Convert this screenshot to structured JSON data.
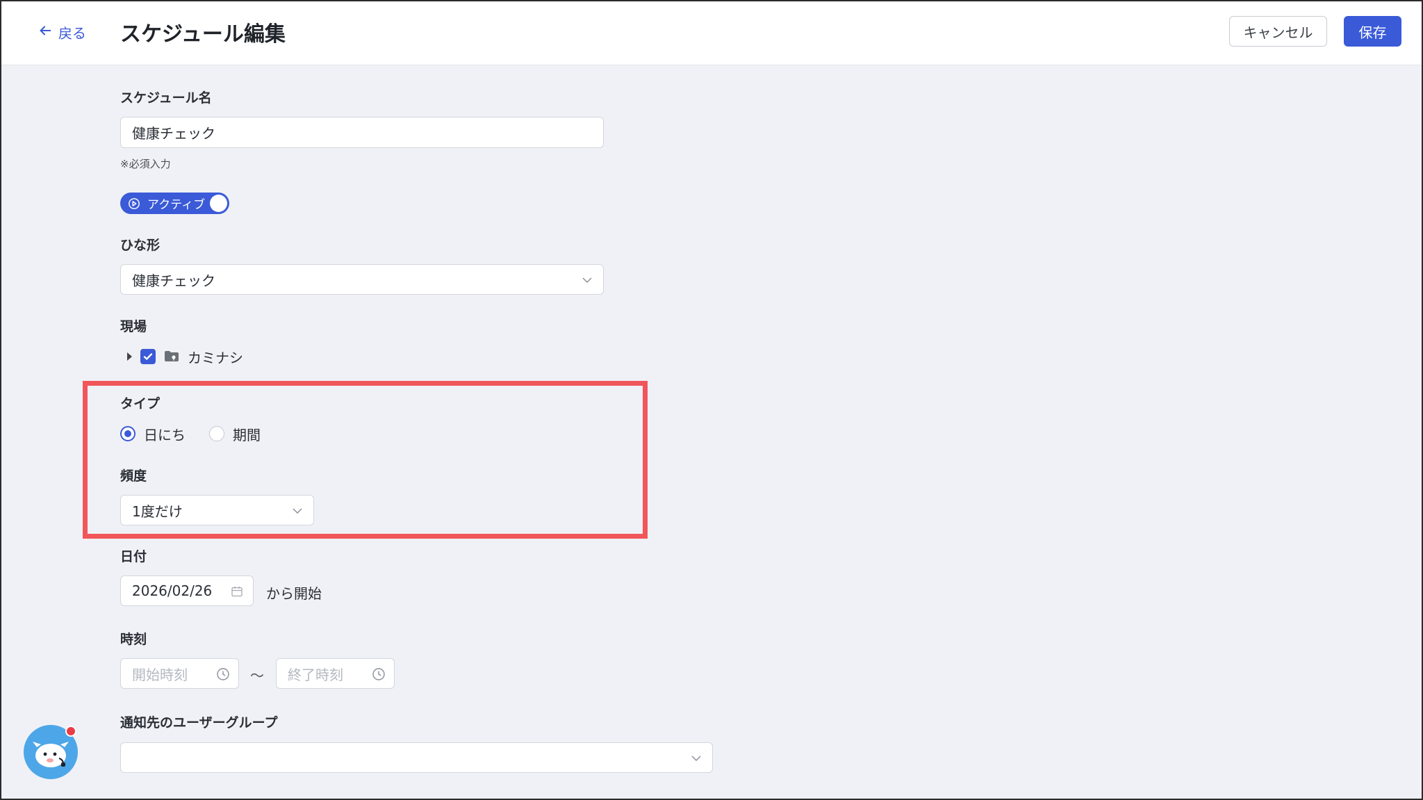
{
  "header": {
    "back_label": "戻る",
    "title": "スケジュール編集",
    "cancel_label": "キャンセル",
    "save_label": "保存"
  },
  "form": {
    "name": {
      "label": "スケジュール名",
      "value": "健康チェック",
      "note": "※必須入力"
    },
    "status_toggle": {
      "label": "アクティブ",
      "on": true
    },
    "template": {
      "label": "ひな形",
      "value": "健康チェック"
    },
    "site": {
      "label": "現場",
      "items": [
        {
          "label": "カミナシ",
          "checked": true
        }
      ]
    },
    "type": {
      "label": "タイプ",
      "options": [
        {
          "label": "日にち",
          "selected": true
        },
        {
          "label": "期間",
          "selected": false
        }
      ]
    },
    "frequency": {
      "label": "頻度",
      "value": "1度だけ"
    },
    "date": {
      "label": "日付",
      "value": "2026/02/26",
      "suffix": "から開始"
    },
    "time": {
      "label": "時刻",
      "start_placeholder": "開始時刻",
      "separator": "〜",
      "end_placeholder": "終了時刻"
    },
    "notify": {
      "label": "通知先のユーザーグループ",
      "value": ""
    }
  },
  "colors": {
    "accent": "#3a5ad8",
    "highlight": "#f0565a",
    "background": "#f0f1f6"
  }
}
